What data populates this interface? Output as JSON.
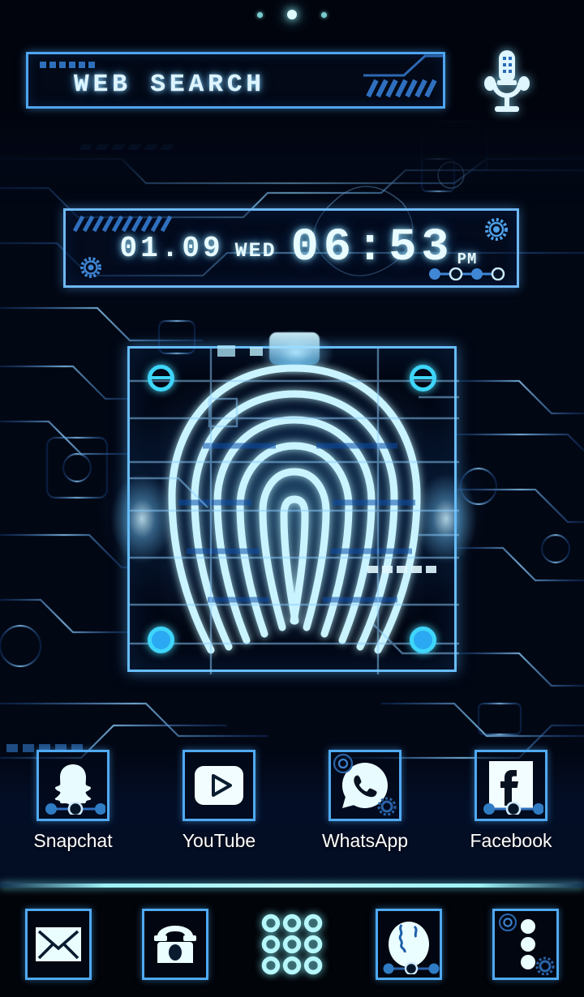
{
  "theme": {
    "accent": "#4fa9f2",
    "glow": "#9df2f6",
    "icon_fill": "#e6fbff",
    "background": "#020714",
    "label_color": "#ffffff"
  },
  "page_indicator": {
    "total": 3,
    "active_index": 1,
    "dots": [
      "page-1",
      "page-2",
      "page-3"
    ]
  },
  "search": {
    "text": "WEB SEARCH",
    "placeholder": "WEB SEARCH",
    "mic_icon": "microphone-icon",
    "deco_icon": "circuit-hatch-deco"
  },
  "clock": {
    "date": "01.09",
    "day": "WED",
    "time": "06:53",
    "ampm": "PM",
    "gear_top_right": "gear-icon",
    "gear_bottom_left": "gear-icon",
    "hatch": "hatch-deco",
    "connector": "connector-dots"
  },
  "fingerprint": {
    "icon": "fingerprint-icon",
    "corners": [
      "corner-marker-tl",
      "corner-marker-tr",
      "corner-marker-bl",
      "corner-marker-br"
    ],
    "dash_count": 5
  },
  "apps": [
    {
      "label": "Snapchat",
      "icon": "snapchat-icon",
      "badge": "connector-dots-badge"
    },
    {
      "label": "YouTube",
      "icon": "youtube-icon",
      "badge": "none"
    },
    {
      "label": "WhatsApp",
      "icon": "whatsapp-icon",
      "badge": "gear-ring-badge"
    },
    {
      "label": "Facebook",
      "icon": "facebook-icon",
      "badge": "connector-dots-badge"
    }
  ],
  "dock": [
    {
      "name": "Mail",
      "icon": "envelope-icon",
      "badge": "none"
    },
    {
      "name": "Phone",
      "icon": "telephone-icon",
      "badge": "none"
    },
    {
      "name": "App Drawer",
      "icon": "app-drawer-grid-icon",
      "badge": "none"
    },
    {
      "name": "Browser",
      "icon": "globe-icon",
      "badge": "connector-dots-badge"
    },
    {
      "name": "Menu",
      "icon": "three-dots-menu-icon",
      "badge": "gear-ring-badge"
    }
  ]
}
